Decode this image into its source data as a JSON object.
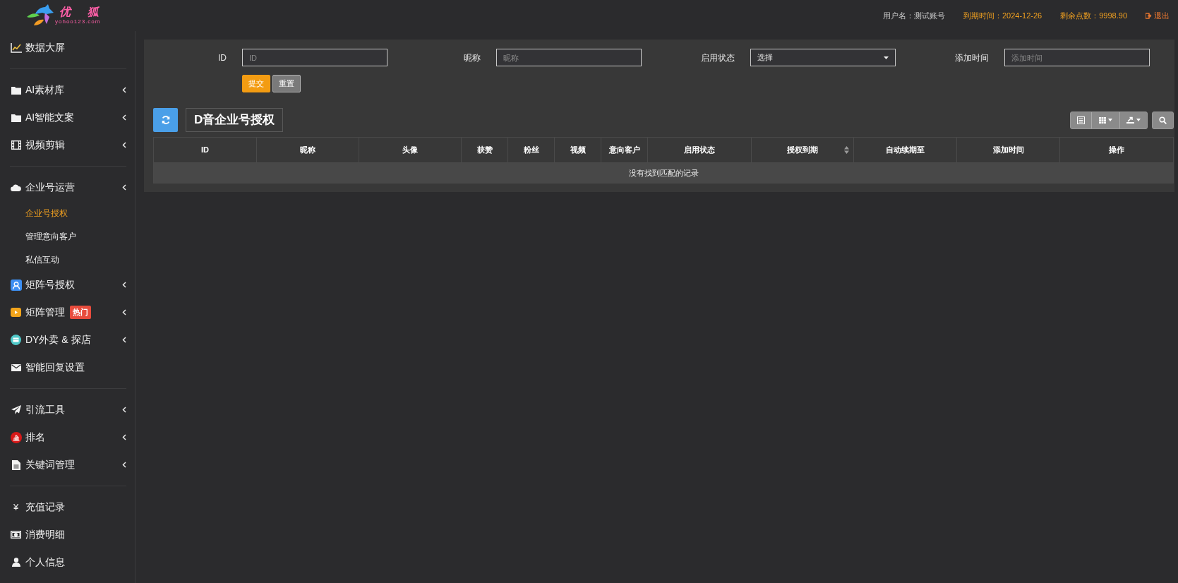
{
  "logo": {
    "chars": [
      "优",
      "狐"
    ],
    "subtitle": "yohoo123.com"
  },
  "header": {
    "user": "用户名：测试账号",
    "expiry": "到期时间：2024-12-26",
    "points": "剩余点数：9998.90",
    "logout": "退出"
  },
  "sidebar": {
    "groups": [
      [
        {
          "label": "数据大屏",
          "kind": "chart",
          "has_submenu": false,
          "selected": false
        }
      ],
      [
        {
          "label": "AI素材库",
          "kind": "folder",
          "has_submenu": true,
          "selected": false
        },
        {
          "label": "AI智能文案",
          "kind": "folder",
          "has_submenu": true,
          "selected": false
        },
        {
          "label": "视频剪辑",
          "kind": "film",
          "has_submenu": true,
          "selected": false
        }
      ],
      [
        {
          "label": "企业号运营",
          "kind": "cloud",
          "has_submenu": true,
          "selected": false,
          "expanded": true,
          "children": [
            {
              "label": "企业号授权",
              "selected": true
            },
            {
              "label": "管理意向客户",
              "selected": false
            },
            {
              "label": "私信互动",
              "selected": false
            }
          ]
        },
        {
          "label": "矩阵号授权",
          "kind": "user-badge",
          "has_submenu": true,
          "selected": false
        },
        {
          "label": "矩阵管理",
          "kind": "play-badge",
          "has_submenu": true,
          "selected": false,
          "badge": "热门"
        },
        {
          "label": "DY外卖 & 探店",
          "kind": "shop-badge",
          "has_submenu": true,
          "selected": false
        },
        {
          "label": "智能回复设置",
          "kind": "mail",
          "has_submenu": false,
          "selected": false
        }
      ],
      [
        {
          "label": "引流工具",
          "kind": "plane",
          "has_submenu": true,
          "selected": false
        },
        {
          "label": "排名",
          "kind": "rank-badge",
          "has_submenu": true,
          "selected": false
        },
        {
          "label": "关键词管理",
          "kind": "file",
          "has_submenu": true,
          "selected": false
        }
      ],
      [
        {
          "label": "充值记录",
          "kind": "glyph",
          "glyph": "¥",
          "has_submenu": false,
          "selected": false
        },
        {
          "label": "消费明细",
          "kind": "money",
          "has_submenu": false,
          "selected": false
        },
        {
          "label": "个人信息",
          "kind": "user",
          "has_submenu": false,
          "selected": false
        }
      ]
    ]
  },
  "filters": [
    {
      "label": "ID",
      "kind": "input",
      "placeholder": "ID"
    },
    {
      "label": "昵称",
      "kind": "input",
      "placeholder": "昵称"
    },
    {
      "label": "启用状态",
      "kind": "select",
      "value": "选择"
    },
    {
      "label": "添加时间",
      "kind": "input",
      "placeholder": "添加时间"
    }
  ],
  "form_buttons": [
    {
      "label": "提交",
      "kind": "primary"
    },
    {
      "label": "重置",
      "kind": "default"
    }
  ],
  "table": {
    "title": "D音企业号授权",
    "columns": [
      {
        "label": "ID",
        "sortable": false
      },
      {
        "label": "昵称",
        "sortable": false
      },
      {
        "label": "头像",
        "sortable": false
      },
      {
        "label": "获赞",
        "sortable": false
      },
      {
        "label": "粉丝",
        "sortable": false
      },
      {
        "label": "视频",
        "sortable": false
      },
      {
        "label": "意向客户",
        "sortable": false
      },
      {
        "label": "启用状态",
        "sortable": false
      },
      {
        "label": "授权到期",
        "sortable": true
      },
      {
        "label": "自动续期至",
        "sortable": false
      },
      {
        "label": "添加时间",
        "sortable": false
      },
      {
        "label": "操作",
        "sortable": false
      }
    ],
    "empty_text": "没有找到匹配的记录"
  }
}
